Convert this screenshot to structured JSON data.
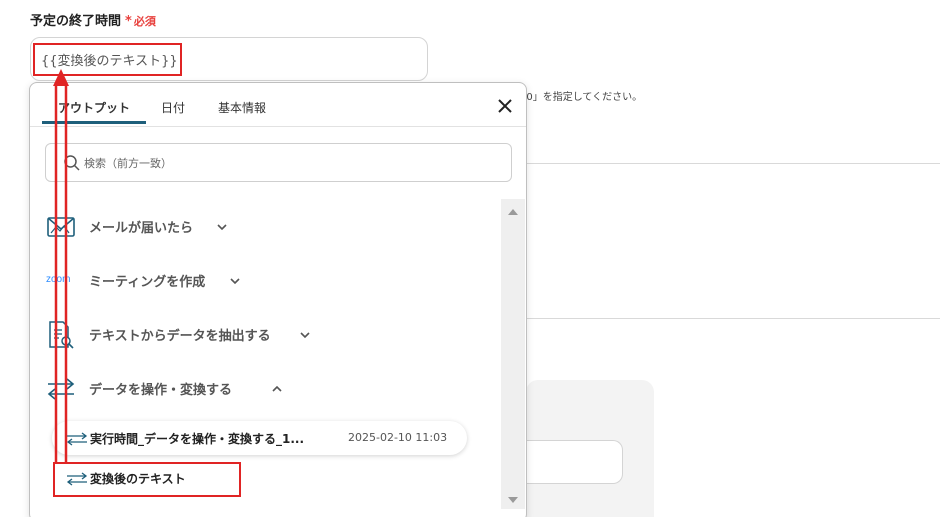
{
  "field": {
    "label": "予定の終了時間",
    "required_mark": "*",
    "required_text": "必須",
    "value": "{{変換後のテキスト}}",
    "hint": "00」を指定してください。"
  },
  "dropdown": {
    "tabs": [
      {
        "label": "アウトプット"
      },
      {
        "label": "日付"
      },
      {
        "label": "基本情報"
      }
    ],
    "search_placeholder": "検索（前方一致）",
    "sections": [
      {
        "label": "メールが届いたら",
        "icon": "mail-icon",
        "expanded": false
      },
      {
        "label": "ミーティングを作成",
        "icon": "zoom-logo",
        "expanded": false
      },
      {
        "label": "テキストからデータを抽出する",
        "icon": "document-search-icon",
        "expanded": false
      },
      {
        "label": "データを操作・変換する",
        "icon": "swap-arrows-icon",
        "expanded": true
      }
    ],
    "items": [
      {
        "label": "実行時間_データを操作・変換する_1...",
        "meta": "2025-02-10 11:03"
      },
      {
        "label": "変換後のテキスト",
        "meta": ""
      }
    ],
    "zoom_logo_text": "zoom"
  },
  "colors": {
    "accent": "#1e5f7b",
    "required": "#e8403d",
    "annotation": "#e02424"
  }
}
